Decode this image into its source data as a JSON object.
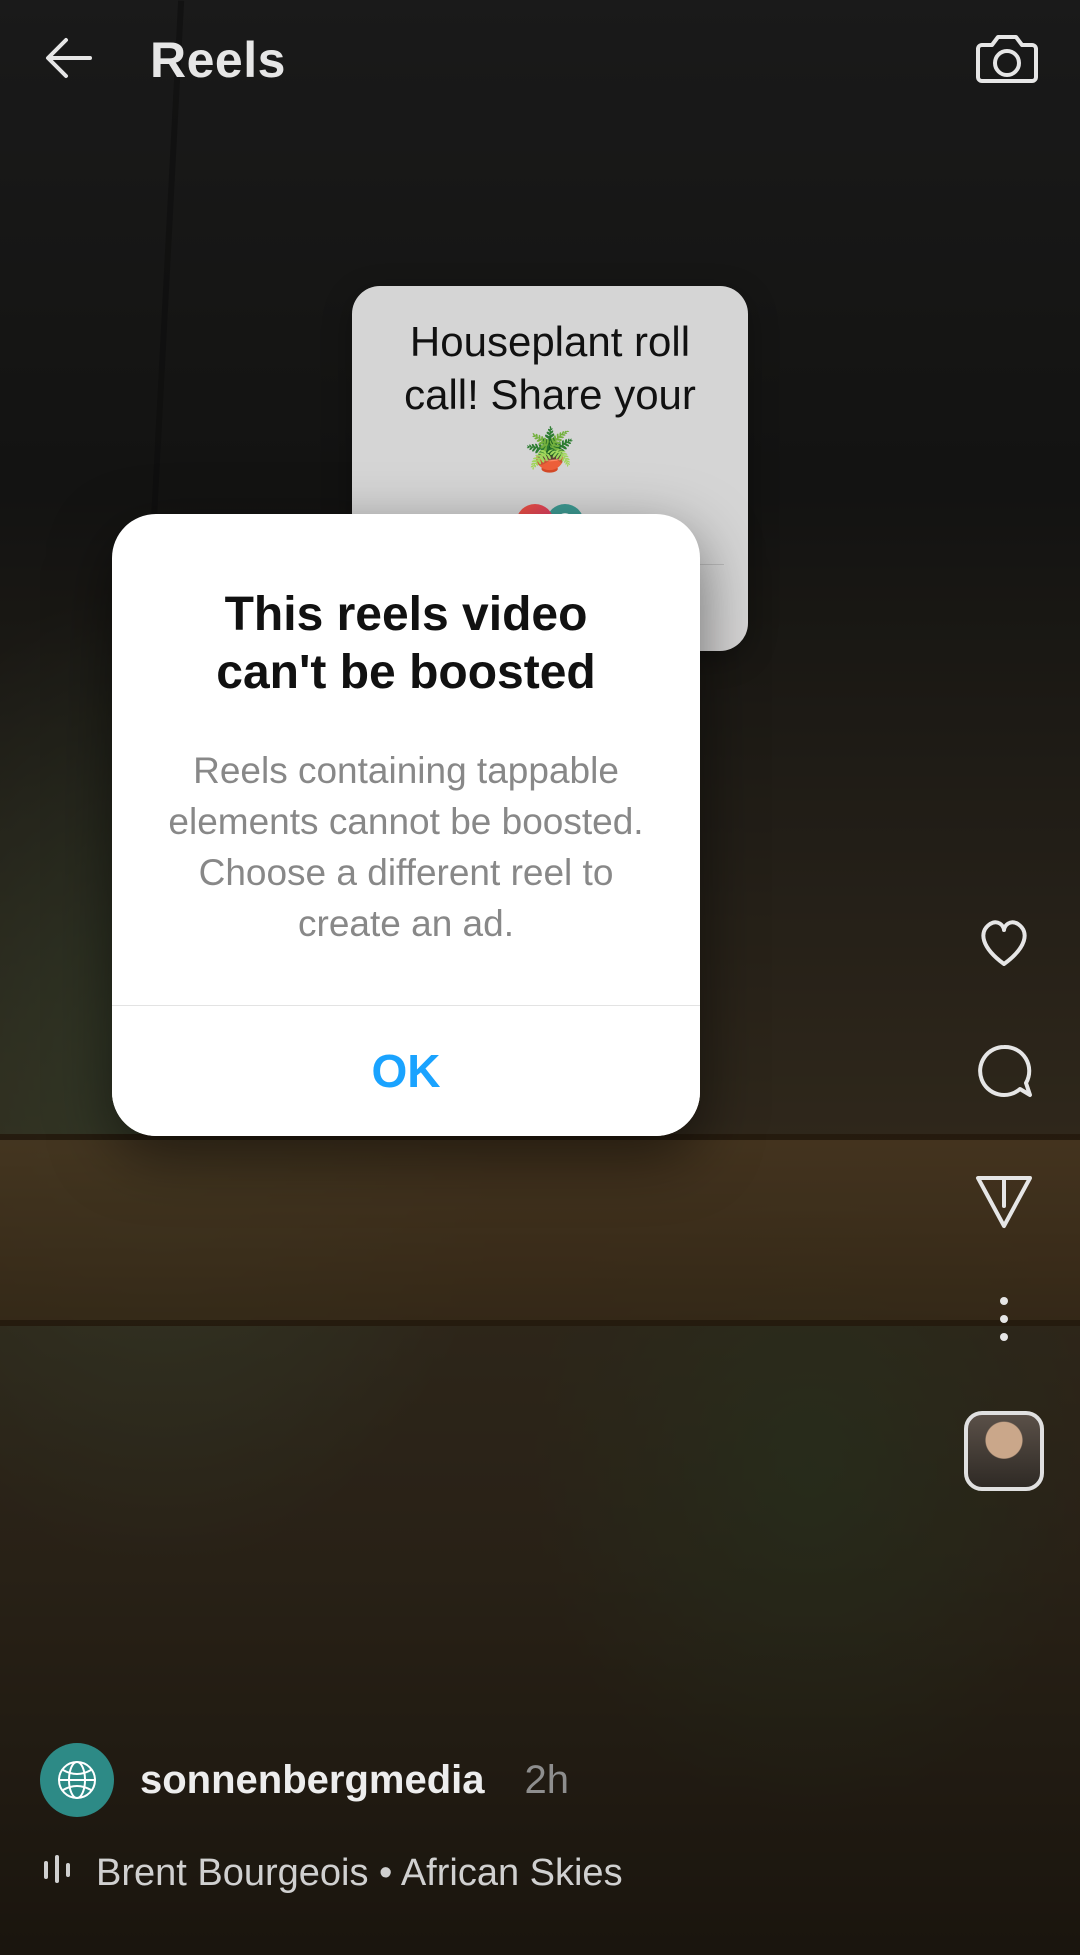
{
  "topbar": {
    "back_icon": "back-arrow-icon",
    "title": "Reels",
    "camera_icon": "camera-icon"
  },
  "sticker": {
    "text_line1": "Houseplant roll",
    "text_line2": "call! Share your",
    "emoji": "🪴",
    "badge1_icon": "reply-icon",
    "badge2_icon": "globe-icon"
  },
  "rail": {
    "like_icon": "heart-icon",
    "comment_icon": "comment-icon",
    "share_icon": "send-icon",
    "more_icon": "more-vertical-icon",
    "audio_thumb": "audio-thumbnail"
  },
  "bottom": {
    "avatar_icon": "globe-icon",
    "username": "sonnenbergmedia",
    "timestamp": "2h",
    "audio_bars_icon": "audio-bars-icon",
    "audio_label": "Brent Bourgeois • African Skies"
  },
  "modal": {
    "title_line1": "This reels video",
    "title_line2": "can't be boosted",
    "body": "Reels containing tappable elements cannot be boosted. Choose a different reel to create an ad.",
    "ok_label": "OK"
  },
  "colors": {
    "accent_blue": "#1aa3ff"
  }
}
